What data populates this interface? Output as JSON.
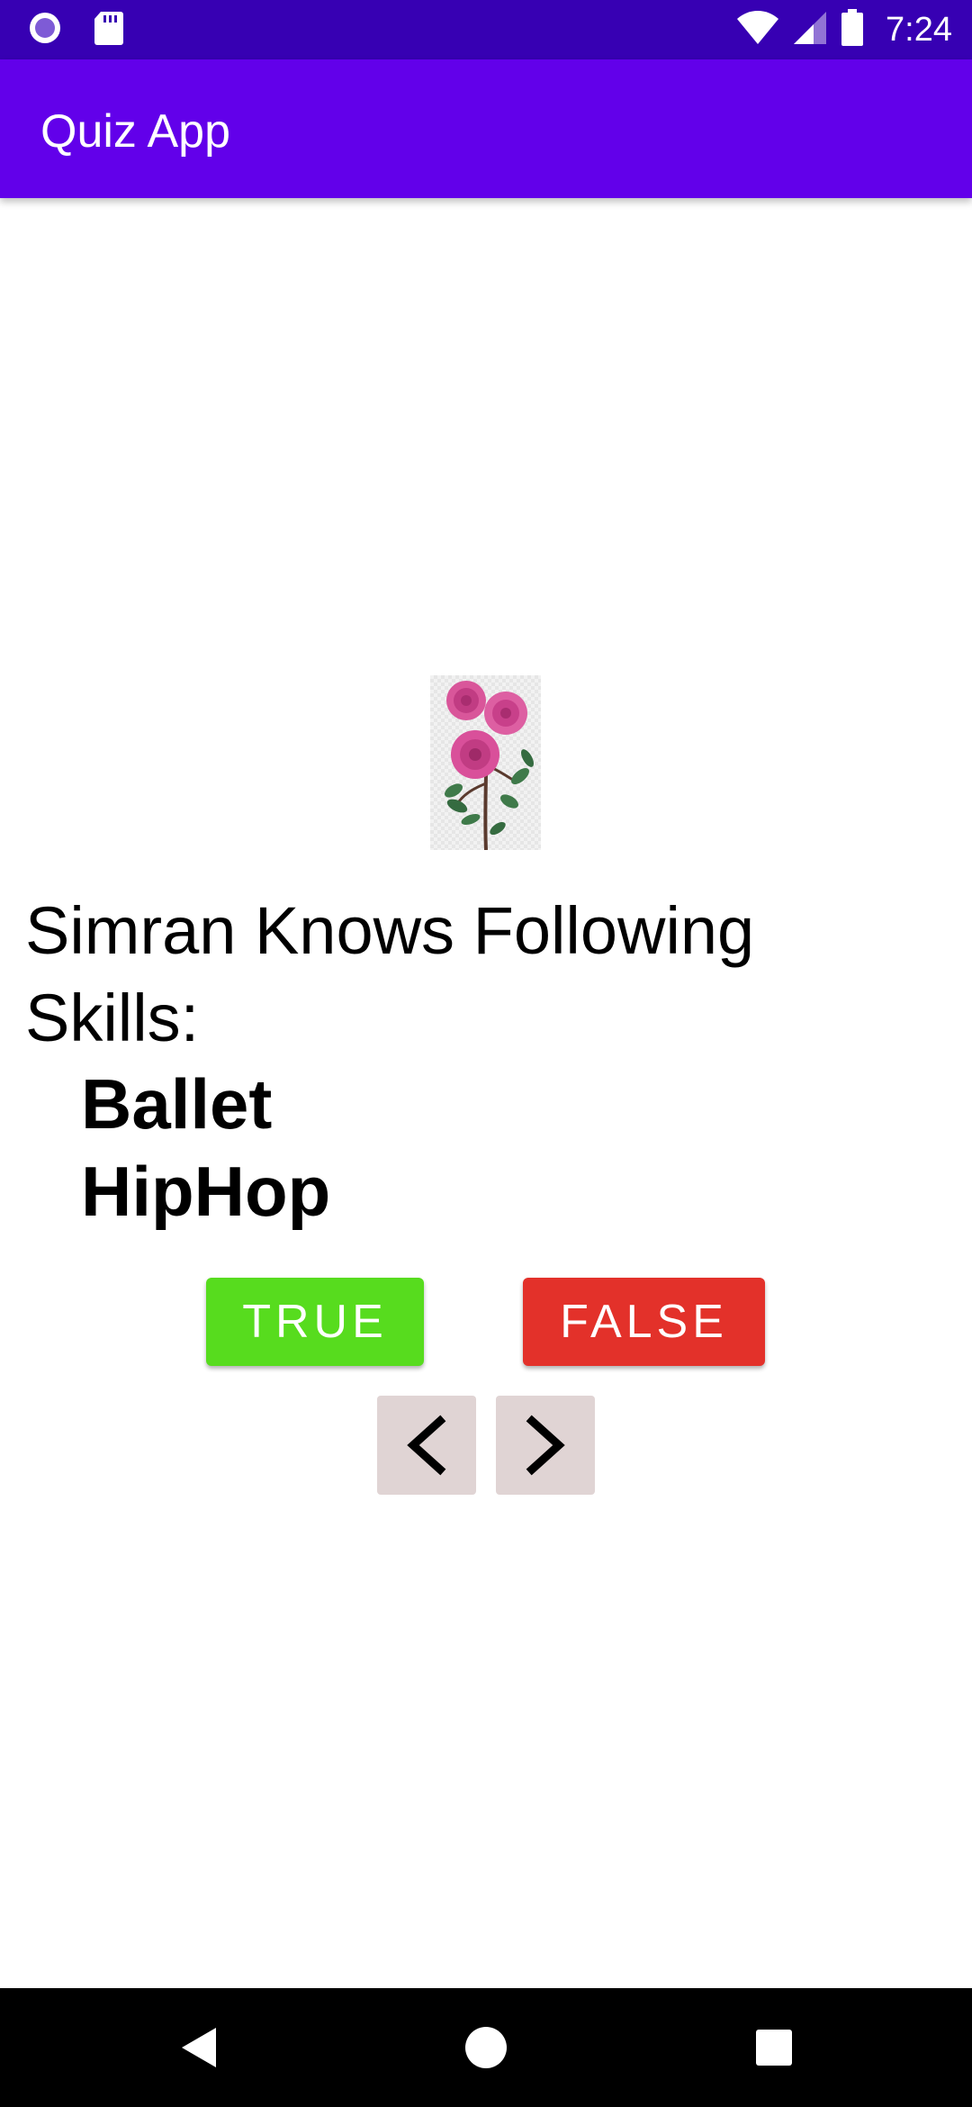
{
  "status_bar": {
    "time": "7:24",
    "icons": [
      "record-icon",
      "sd-card-icon",
      "wifi-icon",
      "signal-icon",
      "battery-icon"
    ],
    "background": "#3700b3"
  },
  "app_bar": {
    "title": "Quiz App",
    "background": "#6200ea"
  },
  "question": {
    "image_icon": "rose-flower-icon",
    "text_line1": "Simran Knows Following",
    "text_line2": "Skills:",
    "skills": [
      "Ballet",
      "HipHop"
    ]
  },
  "answers": {
    "true_label": "TRUE",
    "true_color": "#57dc1e",
    "false_label": "FALSE",
    "false_color": "#e3312a"
  },
  "navigation": {
    "prev_icon": "chevron-left-icon",
    "next_icon": "chevron-right-icon",
    "button_color": "#e0d4d4"
  },
  "system_nav": {
    "icons": [
      "back-triangle-icon",
      "home-circle-icon",
      "recents-square-icon"
    ]
  }
}
